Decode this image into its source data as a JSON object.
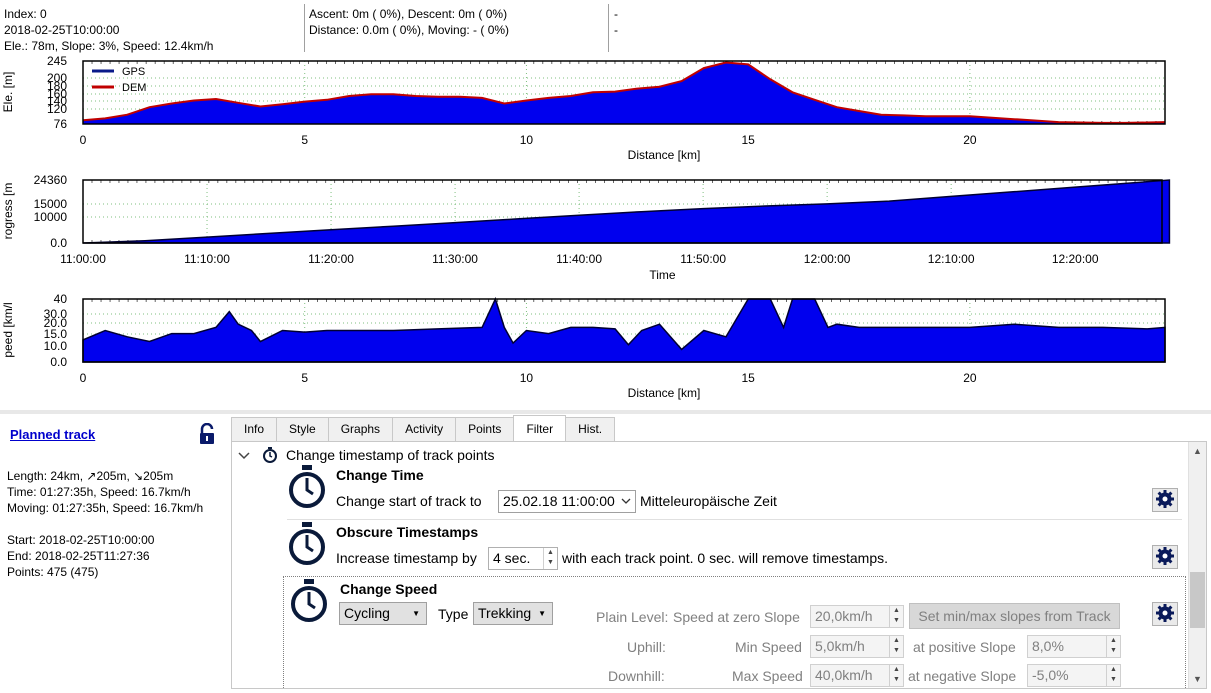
{
  "top_info": {
    "col1": [
      "Index: 0",
      "2018-02-25T10:00:00",
      "Ele.: 78m, Slope: 3%, Speed: 12.4km/h"
    ],
    "col2": [
      "Ascent: 0m ( 0%), Descent: 0m ( 0%)",
      "Distance: 0.0m ( 0%), Moving: - ( 0%)"
    ],
    "col3": [
      "-",
      "-"
    ]
  },
  "chart_data": [
    {
      "type": "area",
      "ylabel": "Ele. [m]",
      "xlabel": "Distance [km]",
      "xlim": [
        0,
        24.4
      ],
      "ylim": [
        76,
        245
      ],
      "y_ticks": [
        "245",
        "200",
        "180",
        "160",
        "140",
        "120",
        "76"
      ],
      "x_ticks": [
        "0",
        "5",
        "10",
        "15",
        "20"
      ],
      "legend": [
        "GPS",
        "DEM"
      ],
      "legend_position": "top-left",
      "series_colors": {
        "GPS": "#0a1a8a",
        "DEM": "#c00000"
      },
      "series": [
        {
          "name": "GPS",
          "x": [
            0,
            0.5,
            1,
            1.5,
            2,
            2.5,
            3,
            3.5,
            4,
            4.5,
            5,
            5.5,
            6,
            6.5,
            7,
            7.5,
            8,
            8.5,
            9,
            9.5,
            10,
            10.5,
            11,
            11.5,
            12,
            12.5,
            13,
            13.5,
            14,
            14.5,
            15,
            15.5,
            16,
            16.5,
            17,
            17.5,
            18,
            18.5,
            19,
            19.5,
            20,
            20.5,
            21,
            21.5,
            22,
            22.5,
            23,
            23.5,
            24,
            24.4
          ],
          "values": [
            85,
            90,
            100,
            120,
            130,
            138,
            142,
            132,
            122,
            128,
            135,
            140,
            150,
            155,
            155,
            150,
            148,
            148,
            145,
            130,
            138,
            145,
            150,
            160,
            162,
            170,
            175,
            190,
            225,
            240,
            235,
            195,
            160,
            140,
            120,
            110,
            100,
            98,
            96,
            96,
            96,
            92,
            88,
            84,
            80,
            79,
            78,
            78,
            79,
            80
          ]
        },
        {
          "name": "DEM",
          "x": [
            0,
            0.5,
            1,
            1.5,
            2,
            2.5,
            3,
            3.5,
            4,
            4.5,
            5,
            5.5,
            6,
            6.5,
            7,
            7.5,
            8,
            8.5,
            9,
            9.5,
            10,
            10.5,
            11,
            11.5,
            12,
            12.5,
            13,
            13.5,
            14,
            14.5,
            15,
            15.5,
            16,
            16.5,
            17,
            17.5,
            18,
            18.5,
            19,
            19.5,
            20,
            20.5,
            21,
            21.5,
            22,
            22.5,
            23,
            23.5,
            24,
            24.4
          ],
          "values": [
            86,
            91,
            101,
            121,
            131,
            139,
            143,
            133,
            123,
            129,
            136,
            141,
            151,
            156,
            156,
            151,
            149,
            149,
            146,
            131,
            139,
            146,
            151,
            161,
            163,
            171,
            176,
            191,
            226,
            241,
            236,
            196,
            161,
            141,
            121,
            111,
            101,
            99,
            97,
            97,
            97,
            93,
            89,
            85,
            81,
            80,
            79,
            79,
            80,
            81
          ]
        }
      ]
    },
    {
      "type": "area",
      "ylabel": "rogress [m",
      "xlabel": "Time",
      "xlim": [
        0,
        87
      ],
      "ylim": [
        0,
        24360
      ],
      "y_ticks": [
        "24360",
        "15000",
        "10000",
        "0.0"
      ],
      "x_ticks": [
        "11:00:00",
        "11:10:00",
        "11:20:00",
        "11:30:00",
        "11:40:00",
        "11:50:00",
        "12:00:00",
        "12:10:00",
        "12:20:00"
      ],
      "series": [
        {
          "x": [
            0,
            5,
            10,
            15,
            20,
            25,
            30,
            35,
            40,
            45,
            50,
            55,
            60,
            65,
            70,
            75,
            80,
            85,
            87.6
          ],
          "values": [
            0,
            900,
            2300,
            3700,
            5100,
            6500,
            7900,
            9300,
            10700,
            12100,
            13300,
            14300,
            15100,
            16200,
            18000,
            19800,
            21600,
            23400,
            24360
          ]
        }
      ]
    },
    {
      "type": "area",
      "ylabel": "peed [km/l",
      "xlabel": "Distance [km]",
      "xlim": [
        0,
        24.4
      ],
      "ylim": [
        0,
        40
      ],
      "y_ticks": [
        "40",
        "30.0",
        "20.0",
        "15.0",
        "10.0",
        "0.0"
      ],
      "x_ticks": [
        "0",
        "5",
        "10",
        "15",
        "20"
      ],
      "series": [
        {
          "x": [
            0,
            0.5,
            1,
            1.5,
            2,
            2.5,
            3,
            3.3,
            3.5,
            3.8,
            4,
            4.5,
            5,
            5.5,
            6,
            7,
            8,
            9,
            9.3,
            9.5,
            9.7,
            10,
            10.5,
            11,
            11.5,
            12,
            12.3,
            12.6,
            13,
            13.5,
            14,
            14.5,
            15,
            15.5,
            15.8,
            16,
            16.5,
            16.8,
            17,
            17.5,
            18,
            19,
            20,
            21,
            22,
            23,
            24,
            24.4
          ],
          "values": [
            14,
            20,
            16,
            13,
            18,
            18,
            22,
            32,
            24,
            20,
            13,
            20,
            19,
            20,
            20,
            20,
            21,
            22,
            40,
            22,
            12,
            20,
            18,
            22,
            22,
            21,
            11,
            20,
            24,
            8,
            20,
            16,
            40,
            40,
            22,
            40,
            40,
            22,
            24,
            22,
            22,
            22,
            22,
            24,
            22,
            22,
            21,
            22
          ]
        }
      ]
    }
  ],
  "left_panel": {
    "planned_track": "Planned track",
    "length": "Length: 24km, ↗205m, ↘205m",
    "time": "Time: 01:27:35h, Speed: 16.7km/h",
    "moving": "Moving: 01:27:35h, Speed: 16.7km/h",
    "start": "Start: 2018-02-25T10:00:00",
    "end": "End: 2018-02-25T11:27:36",
    "points": "Points: 475 (475)"
  },
  "tabs": [
    "Info",
    "Style",
    "Graphs",
    "Activity",
    "Points",
    "Filter",
    "Hist."
  ],
  "active_tab": "Filter",
  "filter": {
    "header": "Change timestamp of track points",
    "change_time": {
      "title": "Change Time",
      "label": "Change start of track to",
      "value": "25.02.18 11:00:00",
      "tz": "Mitteleuropäische Zeit"
    },
    "obscure": {
      "title": "Obscure Timestamps",
      "label_before": "Increase timestamp by",
      "value": "4 sec.",
      "label_after": "with each track point. 0 sec. will remove timestamps."
    },
    "change_speed": {
      "title": "Change Speed",
      "mode": "Cycling",
      "type_label": "Type",
      "type_value": "Trekking",
      "plain_label": "Plain Level:",
      "zero_slope_label": "Speed at zero Slope",
      "zero_slope_value": "20,0km/h",
      "set_slopes_button": "Set min/max slopes from Track",
      "uphill_label": "Uphill:",
      "min_speed_label": "Min Speed",
      "min_speed_value": "5,0km/h",
      "pos_slope_label": "at positive Slope",
      "pos_slope_value": "8,0%",
      "downhill_label": "Downhill:",
      "max_speed_label": "Max Speed",
      "max_speed_value": "40,0km/h",
      "neg_slope_label": "at negative Slope",
      "neg_slope_value": "-5,0%"
    }
  }
}
